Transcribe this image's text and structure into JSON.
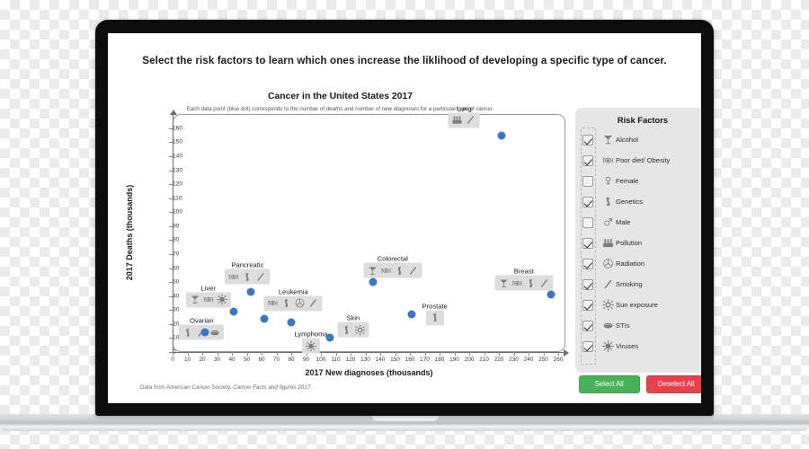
{
  "headline": "Select the risk factors to learn which ones increase the liklihood of developing a specific type of cancer.",
  "chart_title": "Cancer in the United States 2017",
  "chart_subtitle_a": "Each data point (blue dot) corresponds to the number of ",
  "chart_subtitle_b": "deaths",
  "chart_subtitle_c": " and number of ",
  "chart_subtitle_d": "new diagnoses",
  "chart_subtitle_e": " for a particular type of cancer.",
  "footnote_a": "Data from American Cancer Society, ",
  "footnote_b": "Cancer Facts and figures 2017",
  "footnote_c": ".",
  "panel": {
    "title": "Risk Factors",
    "select_all_label": "Select All",
    "deselect_all_label": "Deselect All",
    "select_all_color": "#48b15a",
    "deselect_all_color": "#e8414c",
    "items": [
      {
        "label": "Alcohol",
        "icon": "cocktail-glass-icon",
        "checked": true
      },
      {
        "label": "Poor diet/ Obesity",
        "icon": "plate-utensils-icon",
        "checked": true
      },
      {
        "label": "Female",
        "icon": "female-symbol-icon",
        "checked": false
      },
      {
        "label": "Genetics",
        "icon": "dna-icon",
        "checked": true
      },
      {
        "label": "Male",
        "icon": "male-symbol-icon",
        "checked": false
      },
      {
        "label": "Pollution",
        "icon": "factory-icon",
        "checked": true
      },
      {
        "label": "Radiation",
        "icon": "radiation-icon",
        "checked": true
      },
      {
        "label": "Smoking",
        "icon": "cigarette-icon",
        "checked": true
      },
      {
        "label": "Sun exposure",
        "icon": "sun-icon",
        "checked": true
      },
      {
        "label": "STIs",
        "icon": "sti-icon",
        "checked": true
      },
      {
        "label": "Viruses",
        "icon": "virus-icon",
        "checked": true
      }
    ]
  },
  "chart_data": {
    "type": "scatter",
    "title": "Cancer in the United States 2017",
    "xlabel": "2017 New diagnoses (thousands)",
    "ylabel": "2017 Deaths (thousands)",
    "xlim": [
      0,
      260
    ],
    "ylim": [
      0,
      165
    ],
    "xticks": [
      0,
      10,
      20,
      30,
      40,
      50,
      60,
      70,
      80,
      90,
      100,
      110,
      120,
      130,
      140,
      150,
      160,
      170,
      180,
      190,
      200,
      210,
      220,
      230,
      240,
      250,
      260
    ],
    "yticks": [
      0,
      10,
      20,
      30,
      40,
      50,
      60,
      70,
      80,
      90,
      100,
      110,
      120,
      130,
      140,
      150,
      160
    ],
    "grid": false,
    "legend": "none",
    "dot_color": "#3b78c3",
    "points": [
      {
        "name": "Lung",
        "x": 222,
        "y": 155,
        "label_dx": -42,
        "label_dy": -30,
        "icons": [
          "factory-icon",
          "cigarette-icon"
        ]
      },
      {
        "name": "Breast",
        "x": 255,
        "y": 41,
        "label_dx": -30,
        "label_dy": -26,
        "icons": [
          "cocktail-glass-icon",
          "plate-utensils-icon",
          "dna-icon",
          "cigarette-icon"
        ]
      },
      {
        "name": "Colorectal",
        "x": 135,
        "y": 50,
        "label_dx": 22,
        "label_dy": -26,
        "icons": [
          "cocktail-glass-icon",
          "plate-utensils-icon",
          "dna-icon",
          "cigarette-icon"
        ]
      },
      {
        "name": "Prostate",
        "x": 161,
        "y": 27,
        "label_dx": 26,
        "label_dy": -9,
        "icons": [
          "dna-icon"
        ]
      },
      {
        "name": "Pancreatic",
        "x": 53,
        "y": 43,
        "label_dx": -4,
        "label_dy": -30,
        "icons": [
          "plate-utensils-icon",
          "dna-icon",
          "cigarette-icon"
        ]
      },
      {
        "name": "Leukemia",
        "x": 62,
        "y": 24,
        "label_dx": 32,
        "label_dy": -30,
        "icons": [
          "plate-utensils-icon",
          "dna-icon",
          "radiation-icon",
          "cigarette-icon"
        ]
      },
      {
        "name": "Liver",
        "x": 41,
        "y": 29,
        "label_dx": -28,
        "label_dy": -26,
        "icons": [
          "cocktail-glass-icon",
          "plate-utensils-icon",
          "virus-icon"
        ]
      },
      {
        "name": "Lymphoma",
        "x": 80,
        "y": 21,
        "label_dx": 22,
        "label_dy": 13,
        "icons": [
          "virus-icon"
        ]
      },
      {
        "name": "Ovarian",
        "x": 22,
        "y": 14,
        "label_dx": -4,
        "label_dy": -13,
        "icons": [
          "dna-icon",
          "cigarette-icon",
          "sti-icon"
        ]
      },
      {
        "name": "Skin",
        "x": 106,
        "y": 10,
        "label_dx": 26,
        "label_dy": -22,
        "icons": [
          "dna-icon",
          "sun-icon"
        ]
      }
    ]
  }
}
